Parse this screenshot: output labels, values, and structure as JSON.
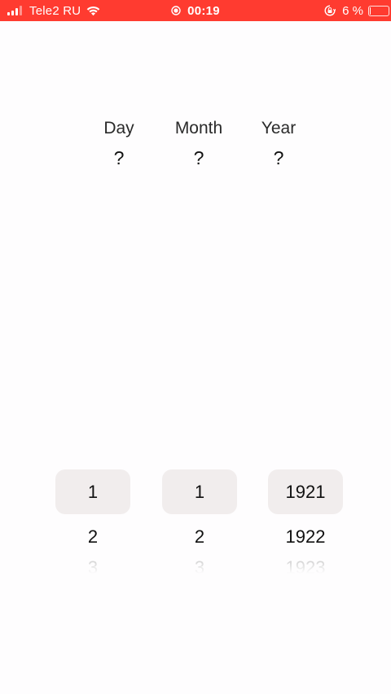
{
  "status_bar": {
    "carrier": "Tele2 RU",
    "time": "00:19",
    "battery_percent": "6 %",
    "battery_level": 0.06,
    "icons": [
      "signal-icon",
      "wifi-icon",
      "screen-record-icon",
      "orientation-lock-icon",
      "battery-icon"
    ],
    "background_color": "#ff3b30"
  },
  "header": {
    "day_label": "Day",
    "month_label": "Month",
    "year_label": "Year",
    "day_value": "?",
    "month_value": "?",
    "year_value": "?"
  },
  "pickers": {
    "day": {
      "selected": "1",
      "next": "2",
      "faded": "3"
    },
    "month": {
      "selected": "1",
      "next": "2",
      "faded": "3"
    },
    "year": {
      "selected": "1921",
      "next": "1922",
      "faded": "1923"
    }
  },
  "colors": {
    "selected_background": "#f1eded",
    "page_background": "#fefdfe"
  }
}
